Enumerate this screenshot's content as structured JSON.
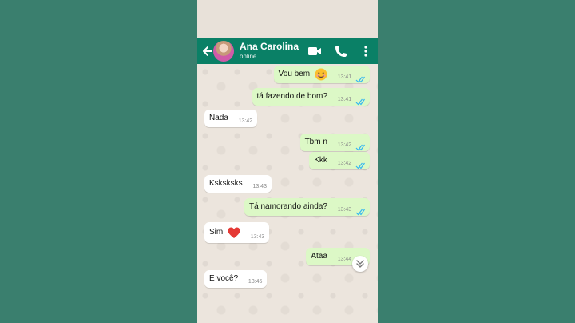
{
  "header": {
    "contact_name": "Ana Carolina",
    "status": "online",
    "icons": [
      "back-arrow-icon",
      "video-call-icon",
      "phone-icon",
      "more-vertical-icon"
    ]
  },
  "messages": [
    {
      "dir": "out",
      "text": "Vou bem",
      "emoji": "smiling-face-emoji",
      "time": "13:41",
      "read": true
    },
    {
      "dir": "out",
      "text": "tá fazendo de bom?",
      "time": "13:41",
      "read": true
    },
    {
      "dir": "in",
      "text": "Nada",
      "time": "13:42"
    },
    {
      "dir": "out",
      "text": "Tbm n",
      "time": "13:42",
      "read": true
    },
    {
      "dir": "out",
      "text": "Kkk",
      "time": "13:42",
      "read": true
    },
    {
      "dir": "in",
      "text": "Ksksksks",
      "time": "13:43"
    },
    {
      "dir": "out",
      "text": "Tá namorando ainda?",
      "time": "13:43",
      "read": true
    },
    {
      "dir": "in",
      "text": "Sim",
      "emoji": "red-heart-emoji",
      "time": "13:43"
    },
    {
      "dir": "out",
      "text": "Ataa",
      "time": "13:44",
      "read": true
    },
    {
      "dir": "in",
      "text": "E você?",
      "time": "13:45"
    }
  ],
  "colors": {
    "header": "#0a8066",
    "outgoing_bubble": "#dcf8c6",
    "incoming_bubble": "#ffffff",
    "read_ticks": "#34b7f1",
    "side_background": "#3a7f6e"
  }
}
